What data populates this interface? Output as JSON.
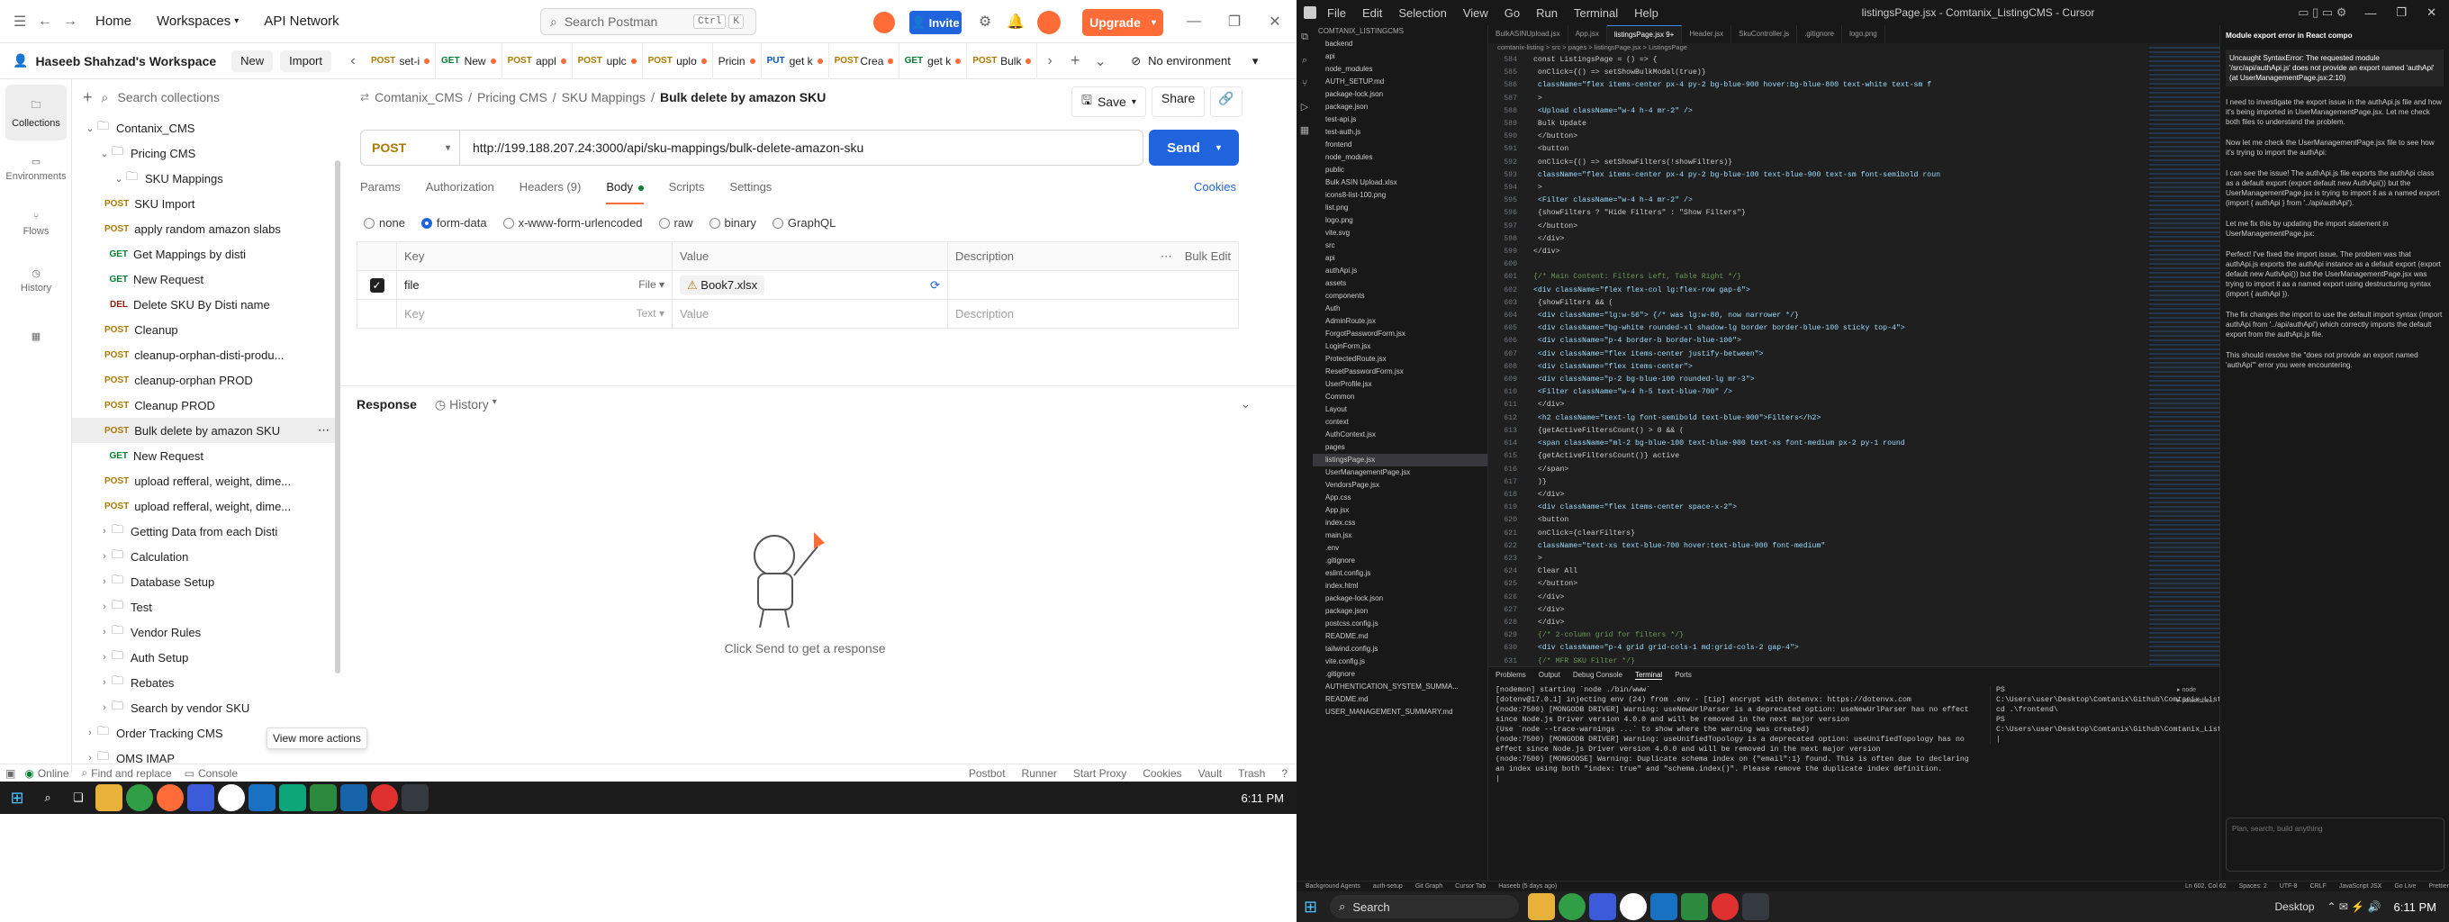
{
  "postman": {
    "nav": {
      "home": "Home",
      "workspaces": "Workspaces",
      "api_network": "API Network"
    },
    "search_placeholder": "Search Postman",
    "search_kbd": [
      "Ctrl",
      "K"
    ],
    "invite": "Invite",
    "upgrade": "Upgrade",
    "workspace_name": "Haseeb Shahzad's Workspace",
    "new_btn": "New",
    "import_btn": "Import",
    "rail": [
      "Collections",
      "Environments",
      "Flows",
      "History"
    ],
    "collection_search_placeholder": "Search collections",
    "tree": [
      {
        "type": "folder",
        "label": "Contanix_CMS",
        "indent": 0,
        "open": true
      },
      {
        "type": "folder",
        "label": "Pricing CMS",
        "indent": 1,
        "open": true
      },
      {
        "type": "folder",
        "label": "SKU Mappings",
        "indent": 2,
        "open": true
      },
      {
        "type": "req",
        "method": "POST",
        "label": "SKU Import"
      },
      {
        "type": "req",
        "method": "POST",
        "label": "apply random amazon slabs"
      },
      {
        "type": "req",
        "method": "GET",
        "label": "Get Mappings by disti"
      },
      {
        "type": "req",
        "method": "GET",
        "label": "New Request"
      },
      {
        "type": "req",
        "method": "DEL",
        "label": "Delete SKU By Disti name"
      },
      {
        "type": "req",
        "method": "POST",
        "label": "Cleanup"
      },
      {
        "type": "req",
        "method": "POST",
        "label": "cleanup-orphan-disti-produ..."
      },
      {
        "type": "req",
        "method": "POST",
        "label": "cleanup-orphan PROD"
      },
      {
        "type": "req",
        "method": "POST",
        "label": "Cleanup PROD"
      },
      {
        "type": "req",
        "method": "POST",
        "label": "Bulk delete by amazon SKU",
        "selected": true
      },
      {
        "type": "req",
        "method": "GET",
        "label": "New Request"
      },
      {
        "type": "req",
        "method": "POST",
        "label": "upload refferal, weight, dime..."
      },
      {
        "type": "req",
        "method": "POST",
        "label": "upload refferal, weight, dime..."
      },
      {
        "type": "folder",
        "label": "Getting Data from each Disti",
        "indent": 1,
        "open": false
      },
      {
        "type": "folder",
        "label": "Calculation",
        "indent": 1,
        "open": false
      },
      {
        "type": "folder",
        "label": "Database Setup",
        "indent": 1,
        "open": false
      },
      {
        "type": "folder",
        "label": "Test",
        "indent": 1,
        "open": false
      },
      {
        "type": "folder",
        "label": "Vendor Rules",
        "indent": 1,
        "open": false
      },
      {
        "type": "folder",
        "label": "Auth Setup",
        "indent": 1,
        "open": false
      },
      {
        "type": "folder",
        "label": "Rebates",
        "indent": 1,
        "open": false
      },
      {
        "type": "folder",
        "label": "Search by vendor SKU",
        "indent": 1,
        "open": false
      },
      {
        "type": "folder",
        "label": "Order Tracking CMS",
        "indent": 0,
        "open": false
      },
      {
        "type": "folder",
        "label": "OMS IMAP",
        "indent": 0,
        "open": false
      }
    ],
    "tooltip": "View more actions",
    "tabs": [
      {
        "method": "POST",
        "label": "set-i"
      },
      {
        "method": "GET",
        "label": "New"
      },
      {
        "method": "POST",
        "label": "appl"
      },
      {
        "method": "POST",
        "label": "uplc"
      },
      {
        "method": "POST",
        "label": "uplo"
      },
      {
        "method": "",
        "label": "Pricin"
      },
      {
        "method": "PUT",
        "label": "get k"
      },
      {
        "method": "POST",
        "label": "Crea"
      },
      {
        "method": "GET",
        "label": "get k"
      },
      {
        "method": "POST",
        "label": "Bulk"
      }
    ],
    "environment": "No environment",
    "breadcrumb": [
      "Comtanix_CMS",
      "Pricing CMS",
      "SKU Mappings",
      "Bulk delete by amazon SKU"
    ],
    "save": "Save",
    "share": "Share",
    "method": "POST",
    "url": "http://199.188.207.24:3000/api/sku-mappings/bulk-delete-amazon-sku",
    "send": "Send",
    "req_tabs": [
      "Params",
      "Authorization",
      "Headers (9)",
      "Body",
      "Scripts",
      "Settings"
    ],
    "cookies": "Cookies",
    "body_modes": [
      "none",
      "form-data",
      "x-www-form-urlencoded",
      "raw",
      "binary",
      "GraphQL"
    ],
    "kv_headers": [
      "Key",
      "Value",
      "Description",
      "Bulk Edit"
    ],
    "kv_row": {
      "key": "file",
      "type": "File",
      "value": "Book7.xlsx"
    },
    "kv_empty": {
      "key": "Key",
      "type": "Text",
      "value": "Value",
      "desc": "Description"
    },
    "response_label": "Response",
    "history_label": "History",
    "empty_response": "Click Send to get a response",
    "status": [
      "Online",
      "Find and replace",
      "Console",
      "Postbot",
      "Runner",
      "Start Proxy",
      "Cookies",
      "Vault",
      "Trash"
    ],
    "clock": "6:11 PM"
  },
  "cursor": {
    "title": "listingsPage.jsx - Comtanix_ListingCMS - Cursor",
    "menu": [
      "File",
      "Edit",
      "Selection",
      "View",
      "Go",
      "Run",
      "Terminal",
      "Help"
    ],
    "editor_tabs": [
      "BulkASINUpload.jsx",
      "App.jsx",
      "listingsPage.jsx 9+",
      "Header.jsx",
      "SkuController.js",
      ".gitignore",
      "logo.png"
    ],
    "breadcrumb": "comtanix-listing > src > pages > listingsPage.jsx > ListingsPage",
    "explorer_title": "COMTANIX_LISTINGCMS",
    "explorer": [
      "backend",
      "api",
      "node_modules",
      "AUTH_SETUP.md",
      "package-lock.json",
      "package.json",
      "test-api.js",
      "test-auth.js",
      "frontend",
      "node_modules",
      "public",
      "Bulk ASIN Upload.xlsx",
      "icons8-list-100.png",
      "list.png",
      "logo.png",
      "vite.svg",
      "src",
      "api",
      "authApi.js",
      "assets",
      "components",
      "Auth",
      "AdminRoute.jsx",
      "ForgotPasswordForm.jsx",
      "LoginForm.jsx",
      "ProtectedRoute.jsx",
      "ResetPasswordForm.jsx",
      "UserProfile.jsx",
      "Common",
      "Layout",
      "context",
      "AuthContext.jsx",
      "pages",
      "listingsPage.jsx",
      "UserManagementPage.jsx",
      "VendorsPage.jsx",
      "App.css",
      "App.jsx",
      "index.css",
      "main.jsx",
      ".env",
      ".gitignore",
      "eslint.config.js",
      "index.html",
      "package-lock.json",
      "package.json",
      "postcss.config.js",
      "README.md",
      "tailwind.config.js",
      "vite.config.js",
      ".gitignore",
      "AUTHENTICATION_SYSTEM_SUMMA...",
      "README.md",
      "USER_MANAGEMENT_SUMMARY.md"
    ],
    "code": [
      {
        "n": "584",
        "t": "const ListingsPage = () => {"
      },
      {
        "n": "585",
        "t": "      onClick={() => setShowBulkModal(true)}"
      },
      {
        "n": "586",
        "t": "      className=\"flex items-center px-4 py-2 bg-blue-900 hover:bg-blue-800 text-white text-sm f"
      },
      {
        "n": "587",
        "t": "    >"
      },
      {
        "n": "588",
        "t": "      <Upload className=\"w-4 h-4 mr-2\" />"
      },
      {
        "n": "589",
        "t": "      Bulk Update"
      },
      {
        "n": "590",
        "t": "    </button>"
      },
      {
        "n": "591",
        "t": "    <button"
      },
      {
        "n": "592",
        "t": "      onClick={() => setShowFilters(!showFilters)}"
      },
      {
        "n": "593",
        "t": "      className=\"flex items-center px-4 py-2 bg-blue-100 text-blue-900 text-sm font-semibold roun"
      },
      {
        "n": "594",
        "t": "    >"
      },
      {
        "n": "595",
        "t": "      <Filter className=\"w-4 h-4 mr-2\" />"
      },
      {
        "n": "596",
        "t": "      {showFilters ? \"Hide Filters\" : \"Show Filters\"}"
      },
      {
        "n": "597",
        "t": "    </button>"
      },
      {
        "n": "598",
        "t": "  </div>"
      },
      {
        "n": "599",
        "t": "</div>"
      },
      {
        "n": "600",
        "t": ""
      },
      {
        "n": "601",
        "t": "{/* Main Content: Filters Left, Table Right */}"
      },
      {
        "n": "602",
        "t": "<div className=\"flex flex-col lg:flex-row gap-6\">"
      },
      {
        "n": "603",
        "t": "  {showFilters && ("
      },
      {
        "n": "604",
        "t": "    <div className=\"lg:w-56\"> {/* was lg:w-80, now narrower */}"
      },
      {
        "n": "605",
        "t": "      <div className=\"bg-white rounded-xl shadow-lg border border-blue-100 sticky top-4\">"
      },
      {
        "n": "606",
        "t": "        <div className=\"p-4 border-b border-blue-100\">"
      },
      {
        "n": "607",
        "t": "          <div className=\"flex items-center justify-between\">"
      },
      {
        "n": "608",
        "t": "            <div className=\"flex items-center\">"
      },
      {
        "n": "609",
        "t": "              <div className=\"p-2 bg-blue-100 rounded-lg mr-3\">"
      },
      {
        "n": "610",
        "t": "                <Filter className=\"w-4 h-5 text-blue-700\" />"
      },
      {
        "n": "611",
        "t": "              </div>"
      },
      {
        "n": "612",
        "t": "              <h2 className=\"text-lg font-semibold text-blue-900\">Filters</h2>"
      },
      {
        "n": "613",
        "t": "              {getActiveFiltersCount() > 0 && ("
      },
      {
        "n": "614",
        "t": "                <span className=\"ml-2 bg-blue-100 text-blue-900 text-xs font-medium px-2 py-1 round"
      },
      {
        "n": "615",
        "t": "                  {getActiveFiltersCount()} active"
      },
      {
        "n": "616",
        "t": "                </span>"
      },
      {
        "n": "617",
        "t": "              )}"
      },
      {
        "n": "618",
        "t": "            </div>"
      },
      {
        "n": "619",
        "t": "            <div className=\"flex items-center space-x-2\">"
      },
      {
        "n": "620",
        "t": "              <button"
      },
      {
        "n": "621",
        "t": "                onClick={clearFilters}"
      },
      {
        "n": "622",
        "t": "                className=\"text-xs text-blue-700 hover:text-blue-900 font-medium\""
      },
      {
        "n": "623",
        "t": "              >"
      },
      {
        "n": "624",
        "t": "                Clear All"
      },
      {
        "n": "625",
        "t": "              </button>"
      },
      {
        "n": "626",
        "t": "            </div>"
      },
      {
        "n": "627",
        "t": "          </div>"
      },
      {
        "n": "628",
        "t": "        </div>"
      },
      {
        "n": "629",
        "t": "        {/* 2-column grid for filters */}"
      },
      {
        "n": "630",
        "t": "        <div className=\"p-4 grid grid-cols-1 md:grid-cols-2 gap-4\">"
      },
      {
        "n": "631",
        "t": "          {/* MFR SKU Filter */}"
      },
      {
        "n": "632",
        "t": "          <div>"
      }
    ],
    "panel_tabs": [
      "Problems",
      "Output",
      "Debug Console",
      "Terminal",
      "Ports"
    ],
    "terminal_left": [
      "[nodemon] starting `node ./bin/www`",
      "[dotenv@17.0.1] injecting env (24) from .env - [tip] encrypt with dotenvx: https://dotenvx.com",
      "(node:7500) [MONGODB DRIVER] Warning: useNewUrlParser is a deprecated option: useNewUrlParser has no effect since Node.js Driver version 4.0.0 and will be removed in the next major version",
      "(Use `node --trace-warnings ...` to show where the warning was created)",
      "(node:7500) [MONGODB DRIVER] Warning: useUnifiedTopology is a deprecated option: useUnifiedTopology has no effect since Node.js Driver version 4.0.0 and will be removed in the next major version",
      "(node:7500) [MONGOOSE] Warning: Duplicate schema index on {\"email\":1} found. This is often due to declaring an index using both \"index: true\" and \"schema.index()\". Please remove the duplicate index definition.",
      "|"
    ],
    "terminal_right": [
      "PS C:\\Users\\user\\Desktop\\Comtanix\\Github\\Comtanix_ListingCMS> cd .\\frontend\\",
      "PS C:\\Users\\user\\Desktop\\Comtanix\\Github\\Comtanix_ListingCMS\\frontend> |"
    ],
    "chat_title": "Module export error in React compo",
    "chat": [
      "Uncaught SyntaxError: The requested module '/src/api/authApi.js' does not provide an export named 'authApi' (at UserManagementPage.jsx:2:10)",
      "I need to investigate the export issue in the authApi.js file and how it's being imported in UserManagementPage.jsx. Let me check both files to understand the problem.",
      "Now let me check the UserManagementPage.jsx file to see how it's trying to import the authApi:",
      "I can see the issue! The authApi.js file exports the authApi class as a default export (export default new AuthApi()) but the UserManagementPage.jsx is trying to import it as a named export (import { authApi } from '../api/authApi').",
      "Let me fix this by updating the import statement in UserManagementPage.jsx:",
      "Perfect! I've fixed the import issue. The problem was that authApi.js exports the authApi instance as a default export (export default new AuthApi()) but the UserManagementPage.jsx was trying to import it as a named export using destructuring syntax (import { authApi }).",
      "The fix changes the import to use the default import syntax (import authApi from '../api/authApi') which correctly imports the default export from the authApi.js file.",
      "This should resolve the \"does not provide an export named 'authApi'\" error you were encountering."
    ],
    "chat_input_placeholder": "Plan, search, build anything",
    "status_items": [
      "Background Agents",
      "auth-setup",
      "Git Graph",
      "Cursor Tab",
      "Haseeb (5 days ago)",
      "Ln 602, Col 62",
      "Spaces: 2",
      "UTF-8",
      "CRLF",
      "JavaScript JSX",
      "Go Live",
      "Prettier"
    ],
    "clock": "6:11 PM",
    "taskbar_search": "Search",
    "desktop": "Desktop"
  },
  "colors": {
    "postman_orange": "#ff6c37",
    "postman_blue": "#1f64dc",
    "cursor_bg": "#1e1e1e"
  }
}
